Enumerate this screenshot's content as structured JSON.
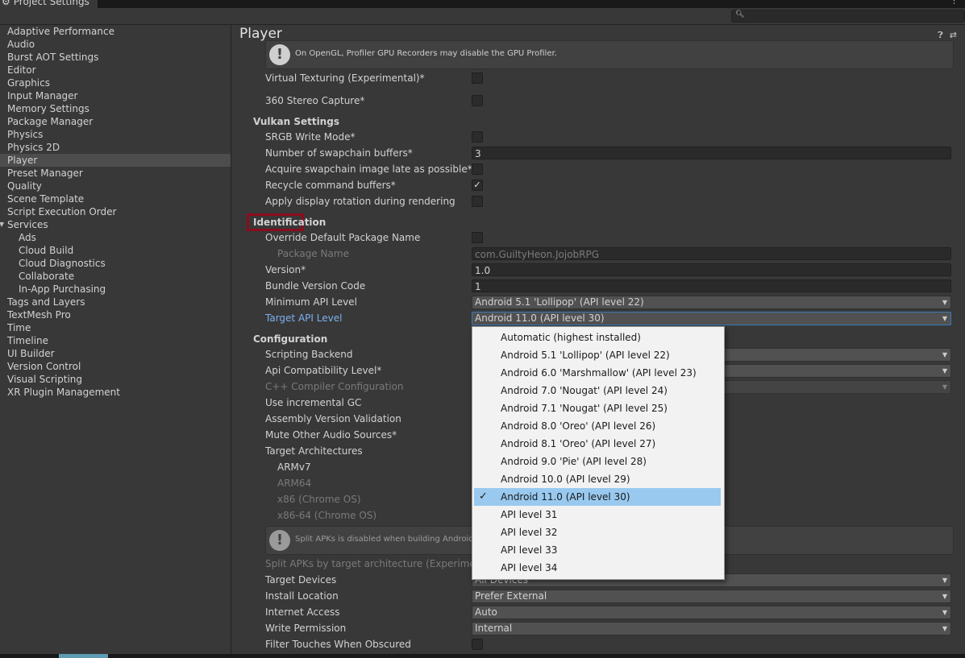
{
  "window": {
    "title": "Project Settings"
  },
  "sidebar": {
    "items": [
      {
        "label": "Adaptive Performance",
        "level": 0
      },
      {
        "label": "Audio",
        "level": 0
      },
      {
        "label": "Burst AOT Settings",
        "level": 0
      },
      {
        "label": "Editor",
        "level": 0
      },
      {
        "label": "Graphics",
        "level": 0
      },
      {
        "label": "Input Manager",
        "level": 0
      },
      {
        "label": "Memory Settings",
        "level": 0
      },
      {
        "label": "Package Manager",
        "level": 0
      },
      {
        "label": "Physics",
        "level": 0
      },
      {
        "label": "Physics 2D",
        "level": 0
      },
      {
        "label": "Player",
        "level": 0,
        "selected": true
      },
      {
        "label": "Preset Manager",
        "level": 0
      },
      {
        "label": "Quality",
        "level": 0
      },
      {
        "label": "Scene Template",
        "level": 0
      },
      {
        "label": "Script Execution Order",
        "level": 0
      },
      {
        "label": "Services",
        "level": 0,
        "expanded": true
      },
      {
        "label": "Ads",
        "level": 1
      },
      {
        "label": "Cloud Build",
        "level": 1
      },
      {
        "label": "Cloud Diagnostics",
        "level": 1
      },
      {
        "label": "Collaborate",
        "level": 1
      },
      {
        "label": "In-App Purchasing",
        "level": 1
      },
      {
        "label": "Tags and Layers",
        "level": 0
      },
      {
        "label": "TextMesh Pro",
        "level": 0
      },
      {
        "label": "Time",
        "level": 0
      },
      {
        "label": "Timeline",
        "level": 0
      },
      {
        "label": "UI Builder",
        "level": 0
      },
      {
        "label": "Version Control",
        "level": 0
      },
      {
        "label": "Visual Scripting",
        "level": 0
      },
      {
        "label": "XR Plugin Management",
        "level": 0
      }
    ]
  },
  "main": {
    "title": "Player",
    "help_opengl": "On OpenGL, Profiler GPU Recorders may disable the GPU Profiler.",
    "virtual_texturing": "Virtual Texturing (Experimental)*",
    "stereo_capture": "360 Stereo Capture*",
    "vulkan_header": "Vulkan Settings",
    "srgb": "SRGB Write Mode*",
    "swapchain": "Number of swapchain buffers*",
    "swapchain_value": "3",
    "acquire": "Acquire swapchain image late as possible*",
    "recycle": "Recycle command buffers*",
    "display_rotation": "Apply display rotation during rendering",
    "identification_header": "Identification",
    "override_pkg": "Override Default Package Name",
    "package_name": "Package Name",
    "package_name_value": "com.GuiltyHeon.JojobRPG",
    "version": "Version*",
    "version_value": "1.0",
    "bundle_code": "Bundle Version Code",
    "bundle_code_value": "1",
    "min_api": "Minimum API Level",
    "min_api_value": "Android 5.1 'Lollipop' (API level 22)",
    "target_api": "Target API Level",
    "target_api_value": "Android 11.0 (API level 30)",
    "configuration_header": "Configuration",
    "scripting_backend": "Scripting Backend",
    "api_compat": "Api Compatibility Level*",
    "cpp_config": "C++ Compiler Configuration",
    "incremental_gc": "Use incremental GC",
    "assembly_validation": "Assembly Version Validation",
    "mute_audio": "Mute Other Audio Sources*",
    "target_arch": "Target Architectures",
    "armv7": "ARMv7",
    "arm64": "ARM64",
    "x86": "x86 (Chrome OS)",
    "x86_64": "x86-64 (Chrome OS)",
    "help_split": "Split APKs is disabled when building Android Ap",
    "split_apks": "Split APKs by target architecture (Experimenta",
    "target_devices": "Target Devices",
    "target_devices_value": "All Devices",
    "install_location": "Install Location",
    "install_location_value": "Prefer External",
    "internet_access": "Internet Access",
    "internet_access_value": "Auto",
    "write_permission": "Write Permission",
    "write_permission_value": "Internal",
    "filter_touches": "Filter Touches When Obscured"
  },
  "dropdown": {
    "options": [
      "Automatic (highest installed)",
      "Android 5.1 'Lollipop' (API level 22)",
      "Android 6.0 'Marshmallow' (API level 23)",
      "Android 7.0 'Nougat' (API level 24)",
      "Android 7.1 'Nougat' (API level 25)",
      "Android 8.0 'Oreo' (API level 26)",
      "Android 8.1 'Oreo' (API level 27)",
      "Android 9.0 'Pie' (API level 28)",
      "Android 10.0 (API level 29)",
      "Android 11.0 (API level 30)",
      "API level 31",
      "API level 32",
      "API level 33",
      "API level 34"
    ],
    "selected": "Android 11.0 (API level 30)"
  },
  "colors": {
    "highlight_box": "#8b0d1d",
    "selection": "#99c9ef",
    "link_label": "#7cb0f0"
  },
  "icons": {
    "help": "help-icon",
    "presets": "preset-sliders-icon",
    "search": "search-icon",
    "warning": "info-exclamation-icon",
    "checkmark": "checkmark-icon"
  }
}
